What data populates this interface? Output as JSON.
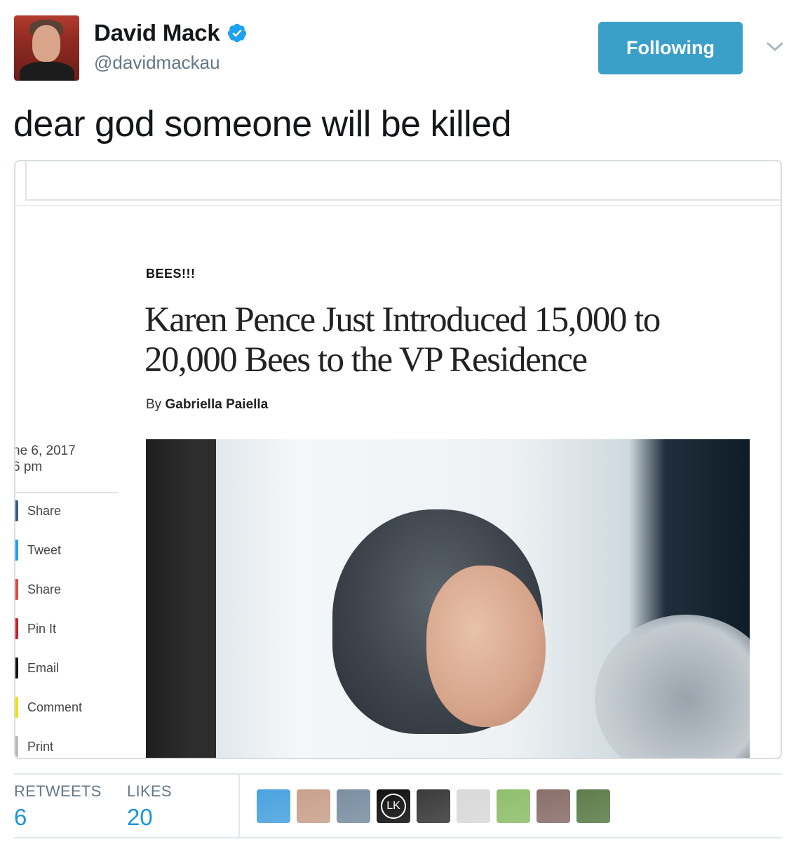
{
  "author": {
    "name": "David Mack",
    "handle": "@davidmackau",
    "verified": true
  },
  "follow_button": {
    "label": "Following"
  },
  "menu": {
    "icon": "chevron-down-icon"
  },
  "tweet": {
    "text": "dear god someone will be killed"
  },
  "article": {
    "kicker": "BEES!!!",
    "headline": "Karen Pence Just Introduced 15,000 to 20,000 Bees to the VP Residence",
    "byline_prefix": "By",
    "byline_author": "Gabriella Paiella",
    "date_line1": "ne 6, 2017",
    "date_line2": "6 pm",
    "share_items": [
      {
        "label": "Share",
        "color": "#3b5998"
      },
      {
        "label": "Tweet",
        "color": "#1da1f2"
      },
      {
        "label": "Share",
        "color": "#dd4b39"
      },
      {
        "label": "Pin It",
        "color": "#cb2027"
      },
      {
        "label": "Email",
        "color": "#111111"
      },
      {
        "label": "Comment",
        "color": "#f5e10a"
      },
      {
        "label": "Print",
        "color": "#bbbbbb"
      }
    ]
  },
  "stats": {
    "retweets_label": "RETWEETS",
    "retweets_value": "6",
    "likes_label": "LIKES",
    "likes_value": "20"
  },
  "likers": [
    {
      "color": "#4aa3df"
    },
    {
      "color": "#c9a18c"
    },
    {
      "color": "#7b8fa3"
    },
    {
      "color": "#111111",
      "text": "LK"
    },
    {
      "color": "#3a3a3a"
    },
    {
      "color": "#d9d9d9"
    },
    {
      "color": "#8fbf6b"
    },
    {
      "color": "#8a6f6a"
    },
    {
      "color": "#5d7d4a"
    }
  ],
  "colors": {
    "accent": "#3ba0c9",
    "link": "#1b95e0",
    "verified": "#1da1f2"
  }
}
